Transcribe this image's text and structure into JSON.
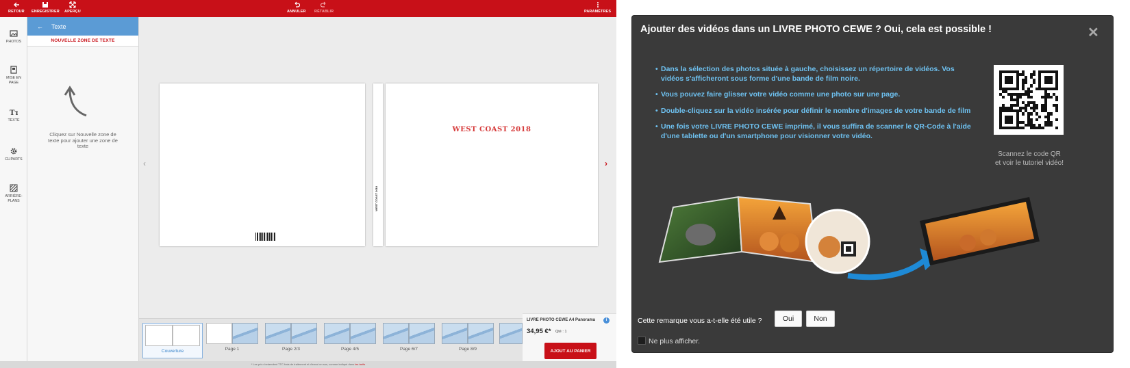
{
  "topbar": {
    "retour": "RETOUR",
    "enregistrer": "ENREGISTRER",
    "apercu": "APERÇU",
    "annuler": "ANNULER",
    "retablir": "RÉTABLIR",
    "parametres": "PARAMÈTRES"
  },
  "leftnav": {
    "photos": "PHOTOS",
    "mise_en_page_1": "MISE EN",
    "mise_en_page_2": "PAGE",
    "texte": "TEXTE",
    "cliparts": "CLIPARTS",
    "arriere_1": "ARRIÈRE-",
    "arriere_2": "PLANS"
  },
  "textpanel": {
    "title": "Texte",
    "new_zone": "NOUVELLE ZONE DE TEXTE",
    "hint": "Cliquez sur Nouvelle zone de texte pour ajouter une zone de texte"
  },
  "book": {
    "cover_title": "WEST COAST 2018",
    "spine_title": "WEST COAST 2018"
  },
  "thumbs": {
    "t0": "Couverture",
    "t1": "Page 1",
    "t2": "Page 2/3",
    "t3": "Page 4/5",
    "t4": "Page 6/7",
    "t5": "Page 8/9"
  },
  "cart": {
    "product": "LIVRE PHOTO CEWE A4 Panorama",
    "price": "34,95 €*",
    "qty": "Qté : 1",
    "button": "AJOUT AU PANIER"
  },
  "footnote": {
    "text": "* Les prix s'entendent TTC frais de traitement et d'envoi en sus, comme indiqué dans ",
    "link": "les tarifs"
  },
  "popup": {
    "title": "Ajouter des vidéos dans un LIVRE PHOTO CEWE ? Oui, cela est possible !",
    "bullets": {
      "b1": "Dans la sélection des photos située à gauche, choisissez un répertoire de vidéos. Vos vidéos s'afficheront sous forme d'une bande de film noire.",
      "b2": "Vous pouvez faire glisser votre vidéo comme une photo sur une page.",
      "b3": "Double-cliquez sur la vidéo insérée pour définir le nombre d'images de votre bande de film",
      "b4": "Une fois votre LIVRE PHOTO CEWE imprimé, il vous suffira de scanner le QR-Code à l'aide d'une tablette ou d'un smartphone pour visionner votre vidéo."
    },
    "qr_caption_1": "Scannez le code QR",
    "qr_caption_2": "et voir le tutoriel vidéo!",
    "question": "Cette remarque vous a-t-elle été utile ?",
    "yes": "Oui",
    "no": "Non",
    "dont_show": "Ne plus afficher.",
    "close_icon": "close-icon"
  },
  "colors": {
    "brand_red": "#c81018",
    "panel_blue": "#5b9bd5",
    "popup_bg": "#3a3a3a",
    "bullet_blue": "#6ec1f0"
  }
}
